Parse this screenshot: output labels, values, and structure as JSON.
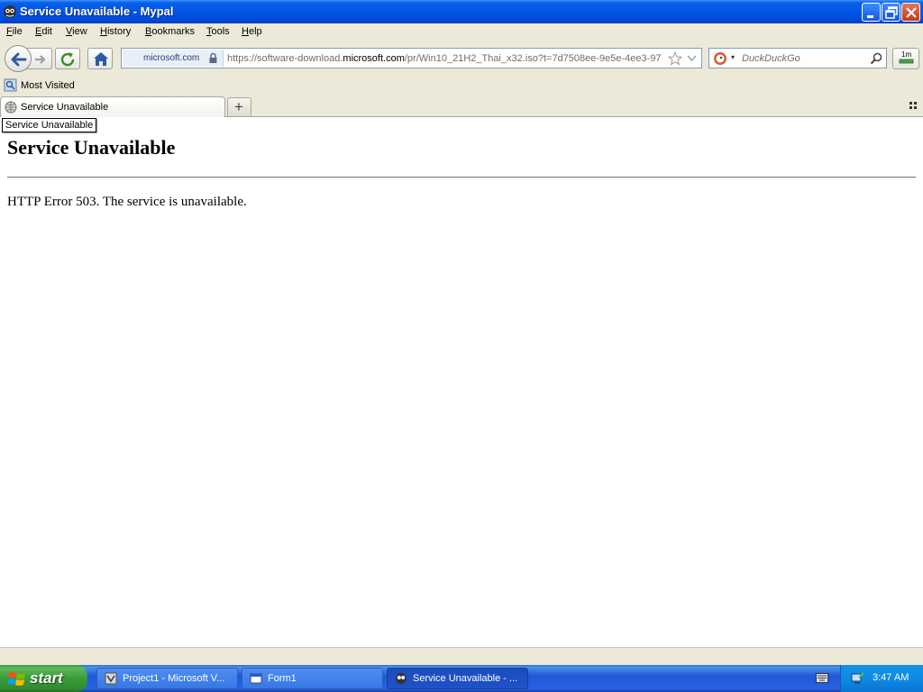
{
  "window": {
    "title": "Service Unavailable - Mypal",
    "icon": "mypal-icon"
  },
  "menu": {
    "items": [
      {
        "label": "File",
        "access": "F",
        "rest": "ile"
      },
      {
        "label": "Edit",
        "access": "E",
        "rest": "dit"
      },
      {
        "label": "View",
        "access": "V",
        "rest": "iew"
      },
      {
        "label": "History",
        "access": "H",
        "rest": "istory"
      },
      {
        "label": "Bookmarks",
        "access": "B",
        "rest": "ookmarks"
      },
      {
        "label": "Tools",
        "access": "T",
        "rest": "ools"
      },
      {
        "label": "Help",
        "access": "H",
        "rest": "elp"
      }
    ]
  },
  "nav": {
    "identity_host": "microsoft.com",
    "url_prefix": "https://software-download.",
    "url_domain": "microsoft.com",
    "url_suffix": "/pr/Win10_21H2_Thai_x32.iso?t=7d7508ee-9e5e-4ee3-97",
    "search_placeholder": "DuckDuckGo",
    "search_engine_icon": "duckduckgo-icon",
    "addon_label": "1m"
  },
  "bookmarks": {
    "items": [
      {
        "label": "Most Visited",
        "icon": "most-visited-icon"
      }
    ]
  },
  "tabs": {
    "items": [
      {
        "label": "Service Unavailable",
        "icon": "globe-icon"
      }
    ],
    "new_tab_label": "+"
  },
  "content": {
    "tooltip": "Service Unavailable",
    "heading": "Service Unavailable",
    "message": "HTTP Error 503. The service is unavailable."
  },
  "taskbar": {
    "start_label": "start",
    "tasks": [
      {
        "label": "Project1 - Microsoft V...",
        "icon": "vb-icon"
      },
      {
        "label": "Form1",
        "icon": "form-icon"
      },
      {
        "label": "Service Unavailable - ...",
        "icon": "mypal-icon"
      }
    ],
    "clock": "3:47 AM"
  },
  "colors": {
    "titlebar": "#0055e5",
    "taskbar": "#245edb",
    "start": "#3a9b3a",
    "chrome": "#ece9d8"
  }
}
